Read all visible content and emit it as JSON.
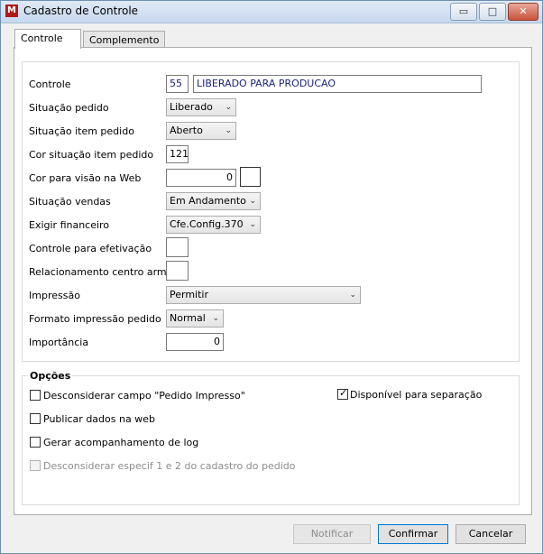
{
  "window": {
    "title": "Cadastro de Controle",
    "min_glyph": "▭",
    "max_glyph": "□",
    "close_glyph": "✕"
  },
  "tabs": [
    {
      "label": "Controle"
    },
    {
      "label": "Complemento"
    }
  ],
  "form": {
    "controle": {
      "label": "Controle",
      "code": "55",
      "description": "LIBERADO PARA PRODUCAO"
    },
    "situacao_pedido": {
      "label": "Situação pedido",
      "value": "Liberado"
    },
    "situacao_item_pedido": {
      "label": "Situação item pedido",
      "value": "Aberto"
    },
    "cor_situacao_item": {
      "label": "Cor situação item pedido",
      "value": "121"
    },
    "cor_visao_web": {
      "label": "Cor para visão na Web",
      "value": "0"
    },
    "situacao_vendas": {
      "label": "Situação vendas",
      "value": "Em Andamento"
    },
    "exigir_financeiro": {
      "label": "Exigir financeiro",
      "value": "Cfe.Config.370"
    },
    "controle_efetivacao": {
      "label": "Controle para efetivação",
      "value": ""
    },
    "relacionamento_centro": {
      "label": "Relacionamento centro armaz.",
      "value": ""
    },
    "impressao": {
      "label": "Impressão",
      "value": "Permitir"
    },
    "formato_impressao": {
      "label": "Formato impressão pedido",
      "value": "Normal"
    },
    "importancia": {
      "label": "Importância",
      "value": "0"
    }
  },
  "opcoes": {
    "title": "Opções",
    "items": [
      {
        "label": "Desconsiderar campo \"Pedido Impresso\"",
        "checked": false,
        "enabled": true
      },
      {
        "label": "Publicar dados na web",
        "checked": false,
        "enabled": true
      },
      {
        "label": "Gerar acompanhamento de log",
        "checked": false,
        "enabled": true
      },
      {
        "label": "Desconsiderar especif 1 e 2 do cadastro do pedido",
        "checked": false,
        "enabled": false
      },
      {
        "label": "Disponível para separação",
        "checked": true,
        "enabled": true
      }
    ]
  },
  "buttons": {
    "notificar": "Notificar",
    "confirmar": "Confirmar",
    "cancelar": "Cancelar"
  },
  "icons": {
    "combo_arrow": "chevron-down-icon",
    "check": "checkmark-icon"
  }
}
